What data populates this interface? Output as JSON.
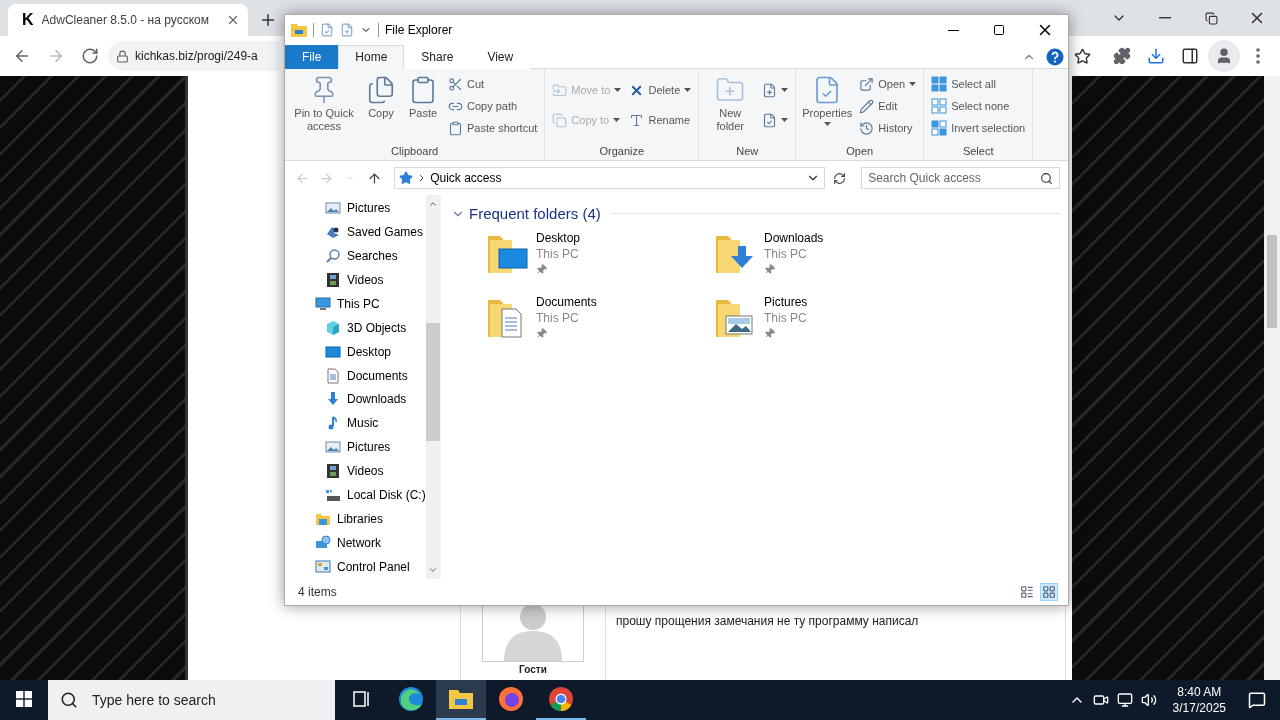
{
  "browser": {
    "tab": {
      "favicon": "K",
      "title": "AdwCleaner 8.5.0 - на русском",
      "selected": true
    },
    "nav_buttons": [
      {
        "kind": "back",
        "disabled": false
      },
      {
        "kind": "forward",
        "disabled": true
      },
      {
        "kind": "reload",
        "disabled": false
      }
    ],
    "url": "kichkas.biz/progi/249-a"
  },
  "page": {
    "comment": {
      "author": "Гости",
      "text": "прошу прощения замечания не ту программу написал"
    }
  },
  "explorer": {
    "title": "File Explorer",
    "ribbon_tabs": [
      {
        "label": "File",
        "kind": "file",
        "selected": false
      },
      {
        "label": "Home",
        "kind": "tab",
        "selected": true
      },
      {
        "label": "Share",
        "kind": "tab",
        "selected": false
      },
      {
        "label": "View",
        "kind": "tab",
        "selected": false
      }
    ],
    "ribbon_groups": [
      {
        "label": "Clipboard",
        "columns": [
          {
            "kind": "large",
            "items": [
              {
                "kind": "pin",
                "label": "Pin to Quick access",
                "menu": false,
                "disabled": false
              }
            ]
          },
          {
            "kind": "large",
            "items": [
              {
                "kind": "copy",
                "label": "Copy",
                "menu": false,
                "disabled": false
              }
            ]
          },
          {
            "kind": "large",
            "items": [
              {
                "kind": "paste",
                "label": "Paste",
                "menu": false,
                "disabled": false
              }
            ]
          },
          {
            "kind": "small",
            "items": [
              {
                "kind": "cut",
                "label": "Cut",
                "menu": false,
                "disabled": false
              },
              {
                "kind": "copypath",
                "label": "Copy path",
                "menu": false,
                "disabled": false
              },
              {
                "kind": "pasteshortcut",
                "label": "Paste shortcut",
                "menu": false,
                "disabled": false
              }
            ]
          }
        ]
      },
      {
        "label": "Organize",
        "columns": [
          {
            "kind": "small",
            "items": [
              {
                "kind": "moveto",
                "label": "Move to",
                "menu": true,
                "disabled": true
              },
              {
                "kind": "copyto",
                "label": "Copy to",
                "menu": true,
                "disabled": true
              }
            ]
          },
          {
            "kind": "small",
            "items": [
              {
                "kind": "delete",
                "label": "Delete",
                "menu": true,
                "disabled": false
              },
              {
                "kind": "rename",
                "label": "Rename",
                "menu": false,
                "disabled": false
              }
            ]
          }
        ]
      },
      {
        "label": "New",
        "columns": [
          {
            "kind": "large",
            "items": [
              {
                "kind": "newfolder",
                "label": "New folder",
                "menu": false,
                "disabled": false
              }
            ]
          },
          {
            "kind": "small",
            "items": [
              {
                "kind": "newitem",
                "menu": true,
                "disabled": false
              },
              {
                "kind": "easyaccess",
                "menu": true,
                "disabled": false
              }
            ]
          }
        ]
      },
      {
        "label": "Open",
        "columns": [
          {
            "kind": "large",
            "items": [
              {
                "kind": "properties",
                "label": "Properties",
                "menu": true,
                "disabled": false
              }
            ]
          },
          {
            "kind": "small",
            "items": [
              {
                "kind": "open",
                "label": "Open",
                "menu": true,
                "disabled": false
              },
              {
                "kind": "edit",
                "label": "Edit",
                "menu": false,
                "disabled": false
              },
              {
                "kind": "history",
                "label": "History",
                "menu": false,
                "disabled": false
              }
            ]
          }
        ]
      },
      {
        "label": "Select",
        "columns": [
          {
            "kind": "small",
            "items": [
              {
                "kind": "selectall",
                "label": "Select all",
                "menu": false,
                "disabled": false
              },
              {
                "kind": "selectnone",
                "label": "Select none",
                "menu": false,
                "disabled": false
              },
              {
                "kind": "invert",
                "label": "Invert selection",
                "menu": false,
                "disabled": false
              }
            ]
          }
        ]
      }
    ],
    "nav_buttons": [
      {
        "kind": "back",
        "disabled": true
      },
      {
        "kind": "forward",
        "disabled": true
      },
      {
        "kind": "recent",
        "disabled": true
      },
      {
        "kind": "up",
        "disabled": false
      }
    ],
    "address": "Quick access",
    "search": {
      "placeholder": "Search Quick access"
    },
    "nav_tree": [
      {
        "children": [
          {
            "label": "Pictures",
            "kind": "pictures"
          },
          {
            "label": "Saved Games",
            "kind": "games"
          },
          {
            "label": "Searches",
            "kind": "search"
          },
          {
            "label": "Videos",
            "kind": "videos"
          }
        ]
      },
      {
        "label": "This PC",
        "kind": "pc",
        "children": [
          {
            "label": "3D Objects",
            "kind": "objects3d"
          },
          {
            "label": "Desktop",
            "kind": "desktop"
          },
          {
            "label": "Documents",
            "kind": "documents"
          },
          {
            "label": "Downloads",
            "kind": "downloads"
          },
          {
            "label": "Music",
            "kind": "music"
          },
          {
            "label": "Pictures",
            "kind": "pictures"
          },
          {
            "label": "Videos",
            "kind": "videos"
          },
          {
            "label": "Local Disk (C:)",
            "kind": "disk"
          }
        ]
      },
      {
        "label": "Libraries",
        "kind": "libraries"
      },
      {
        "label": "Network",
        "kind": "network"
      },
      {
        "label": "Control Panel",
        "kind": "control"
      }
    ],
    "frequent": {
      "title": "Frequent folders (4)",
      "expanded": true,
      "folders": [
        {
          "name": "Desktop",
          "location": "This PC",
          "kind": "desktop",
          "pinned": true
        },
        {
          "name": "Downloads",
          "location": "This PC",
          "kind": "downloads",
          "pinned": true
        },
        {
          "name": "Documents",
          "location": "This PC",
          "kind": "documents",
          "pinned": true
        },
        {
          "name": "Pictures",
          "location": "This PC",
          "kind": "pictures",
          "pinned": true
        }
      ]
    },
    "status": {
      "count": "4 items",
      "views": [
        {
          "kind": "details",
          "selected": false
        },
        {
          "kind": "large",
          "selected": true
        }
      ]
    }
  },
  "taskbar": {
    "search_placeholder": "Type here to search",
    "apps": [
      {
        "kind": "taskview",
        "open": false,
        "active": false
      },
      {
        "kind": "edge",
        "open": false,
        "active": false
      },
      {
        "kind": "explorer",
        "open": true,
        "active": true
      },
      {
        "kind": "firefox",
        "open": false,
        "active": false
      },
      {
        "kind": "chrome",
        "open": true,
        "active": false
      }
    ],
    "time": "8:40 AM",
    "date": "3/17/2025"
  }
}
